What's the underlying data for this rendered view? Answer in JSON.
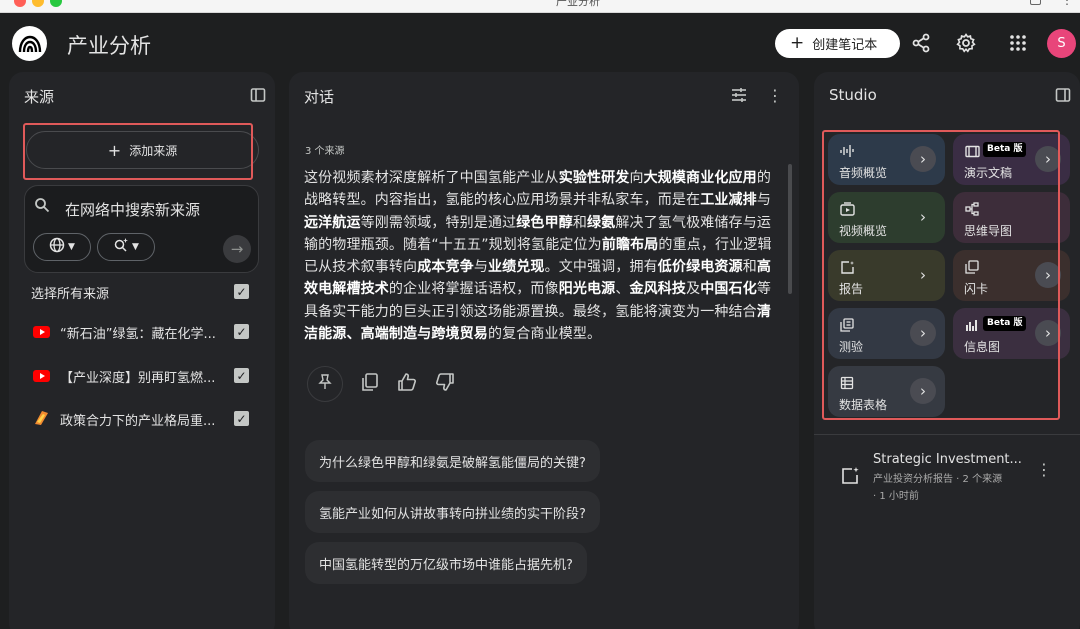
{
  "window": {
    "title": "产业分析"
  },
  "header": {
    "title": "产业分析",
    "create_label": "创建笔记本",
    "avatar_letter": "S"
  },
  "sources_panel": {
    "title": "来源",
    "add_source_label": "添加来源",
    "search_placeholder": "在网络中搜索新来源",
    "select_all_label": "选择所有来源",
    "items": [
      {
        "label": "“新石油”绿氢：藏在化学...",
        "type": "youtube",
        "checked": true
      },
      {
        "label": "【产业深度】别再盯氢燃...",
        "type": "youtube",
        "checked": true
      },
      {
        "label": "政策合力下的产业格局重...",
        "type": "document",
        "checked": true
      }
    ]
  },
  "chat_panel": {
    "title": "对话",
    "source_count": "3 个来源",
    "response_segments": [
      {
        "t": "这份视频素材深度解析了中国氢能产业从",
        "b": false
      },
      {
        "t": "实验性研发",
        "b": true
      },
      {
        "t": "向",
        "b": false
      },
      {
        "t": "大规模商业化应用",
        "b": true
      },
      {
        "t": "的战略转型。内容指出，氢能的核心应用场景并非私家车，而是在",
        "b": false
      },
      {
        "t": "工业减排",
        "b": true
      },
      {
        "t": "与",
        "b": false
      },
      {
        "t": "远洋航运",
        "b": true
      },
      {
        "t": "等刚需领域，特别是通过",
        "b": false
      },
      {
        "t": "绿色甲醇",
        "b": true
      },
      {
        "t": "和",
        "b": false
      },
      {
        "t": "绿氨",
        "b": true
      },
      {
        "t": "解决了氢气极难储存与运输的物理瓶颈。随着“十五五”规划将氢能定位为",
        "b": false
      },
      {
        "t": "前瞻布局",
        "b": true
      },
      {
        "t": "的重点，行业逻辑已从技术叙事转向",
        "b": false
      },
      {
        "t": "成本竞争",
        "b": true
      },
      {
        "t": "与",
        "b": false
      },
      {
        "t": "业绩兑现",
        "b": true
      },
      {
        "t": "。文中强调，拥有",
        "b": false
      },
      {
        "t": "低价绿电资源",
        "b": true
      },
      {
        "t": "和",
        "b": false
      },
      {
        "t": "高效电解槽技术",
        "b": true
      },
      {
        "t": "的企业将掌握话语权，而像",
        "b": false
      },
      {
        "t": "阳光电源",
        "b": true
      },
      {
        "t": "、",
        "b": false
      },
      {
        "t": "金风科技",
        "b": true
      },
      {
        "t": "及",
        "b": false
      },
      {
        "t": "中国石化",
        "b": true
      },
      {
        "t": "等具备实干能力的巨头正引领这场能源置换。最终，氢能将演变为一种结合",
        "b": false
      },
      {
        "t": "清洁能源、高端制造与跨境贸易",
        "b": true
      },
      {
        "t": "的复合商业模型。",
        "b": false
      }
    ],
    "suggestions": [
      "为什么绿色甲醇和绿氨是破解氢能僵局的关键?",
      "氢能产业如何从讲故事转向拼业绩的实干阶段?",
      "中国氢能转型的万亿级市场中谁能占据先机?"
    ]
  },
  "studio_panel": {
    "title": "Studio",
    "tiles": [
      {
        "label": "音频概览",
        "icon": "audio-waveform-icon",
        "badge": "",
        "color": "#2d3a4a"
      },
      {
        "label": "演示文稿",
        "icon": "slides-icon",
        "badge": "Beta 版",
        "color": "#3a2d44"
      },
      {
        "label": "视频概览",
        "icon": "video-icon",
        "badge": "",
        "color": "#2d3d2e"
      },
      {
        "label": "思维导图",
        "icon": "mind-map-icon",
        "badge": "",
        "color": "#3d2d3a"
      },
      {
        "label": "报告",
        "icon": "report-icon",
        "badge": "",
        "color": "#393a2b"
      },
      {
        "label": "闪卡",
        "icon": "flashcard-icon",
        "badge": "",
        "color": "#3b2f2d"
      },
      {
        "label": "测验",
        "icon": "quiz-icon",
        "badge": "",
        "color": "#333944"
      },
      {
        "label": "信息图",
        "icon": "infographic-icon",
        "badge": "Beta 版",
        "color": "#3b2f40"
      },
      {
        "label": "数据表格",
        "icon": "table-icon",
        "badge": "",
        "color": "#363a42"
      }
    ],
    "note": {
      "title": "Strategic Investment...",
      "subtitle": "产业投资分析报告 · 2 个来源",
      "time": "· 1 小时前"
    }
  },
  "colors": {
    "background": "#1e1f20",
    "panel": "#242528",
    "highlight_box": "#e05a5a",
    "avatar": "#e8457a"
  }
}
